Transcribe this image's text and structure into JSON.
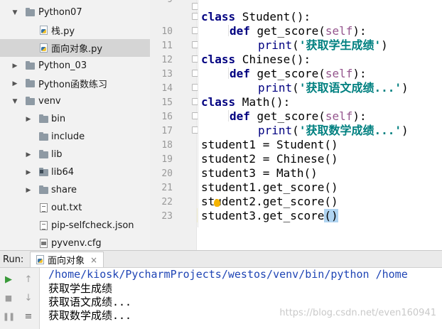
{
  "project_tree": {
    "items": [
      {
        "label": "Python07",
        "icon": "folder-icon",
        "expanded": true
      },
      {
        "label": "栈.py",
        "icon": "python-file-icon"
      },
      {
        "label": "面向对象.py",
        "icon": "python-file-icon",
        "selected": true
      },
      {
        "label": "Python_03",
        "icon": "folder-icon",
        "expanded": false
      },
      {
        "label": "Python函数练习",
        "icon": "folder-icon",
        "expanded": false
      },
      {
        "label": "venv",
        "icon": "folder-icon",
        "expanded": true
      },
      {
        "label": "bin",
        "icon": "folder-icon",
        "expanded": false
      },
      {
        "label": "include",
        "icon": "folder-icon"
      },
      {
        "label": "lib",
        "icon": "folder-icon",
        "expanded": false
      },
      {
        "label": "lib64",
        "icon": "library-folder-icon",
        "expanded": false
      },
      {
        "label": "share",
        "icon": "folder-icon",
        "expanded": false
      },
      {
        "label": "out.txt",
        "icon": "text-file-icon"
      },
      {
        "label": "pip-selfcheck.json",
        "icon": "text-file-icon"
      },
      {
        "label": "pyvenv.cfg",
        "icon": "config-file-icon"
      }
    ]
  },
  "editor": {
    "line_numbers": [
      "9",
      "10",
      "11",
      "12",
      "13",
      "14",
      "15",
      "16",
      "17",
      "18",
      "19",
      "20",
      "21",
      "22",
      "23"
    ],
    "lines": [
      [
        "class",
        " Student():"
      ],
      [
        "def",
        " get_score(",
        "self",
        "):"
      ],
      [
        "print",
        "(",
        "'获取学生成绩'",
        ")"
      ],
      [
        "class",
        " Chinese():"
      ],
      [
        "def",
        " get_score(",
        "self",
        "):"
      ],
      [
        "print",
        "(",
        "'获取语文成绩...'",
        ")"
      ],
      [
        "class",
        " Math():"
      ],
      [
        "def",
        " get_score(",
        "self",
        "):"
      ],
      [
        "print",
        "(",
        "'获取数学成绩...'",
        ")"
      ],
      "student1 = Student()",
      "student2 = Chinese()",
      "student3 = Math()",
      "student1.get_score()",
      "student2.get_score()",
      [
        "student3.get_score",
        "()"
      ]
    ]
  },
  "run_panel": {
    "label": "Run:",
    "tab_label": "面向对象",
    "tab_close": "×",
    "console_lines": [
      "/home/kiosk/PycharmProjects/westos/venv/bin/python /home",
      "获取学生成绩",
      "获取语文成绩...",
      "获取数学成绩..."
    ],
    "watermark": "https://blog.csdn.net/even160941"
  }
}
